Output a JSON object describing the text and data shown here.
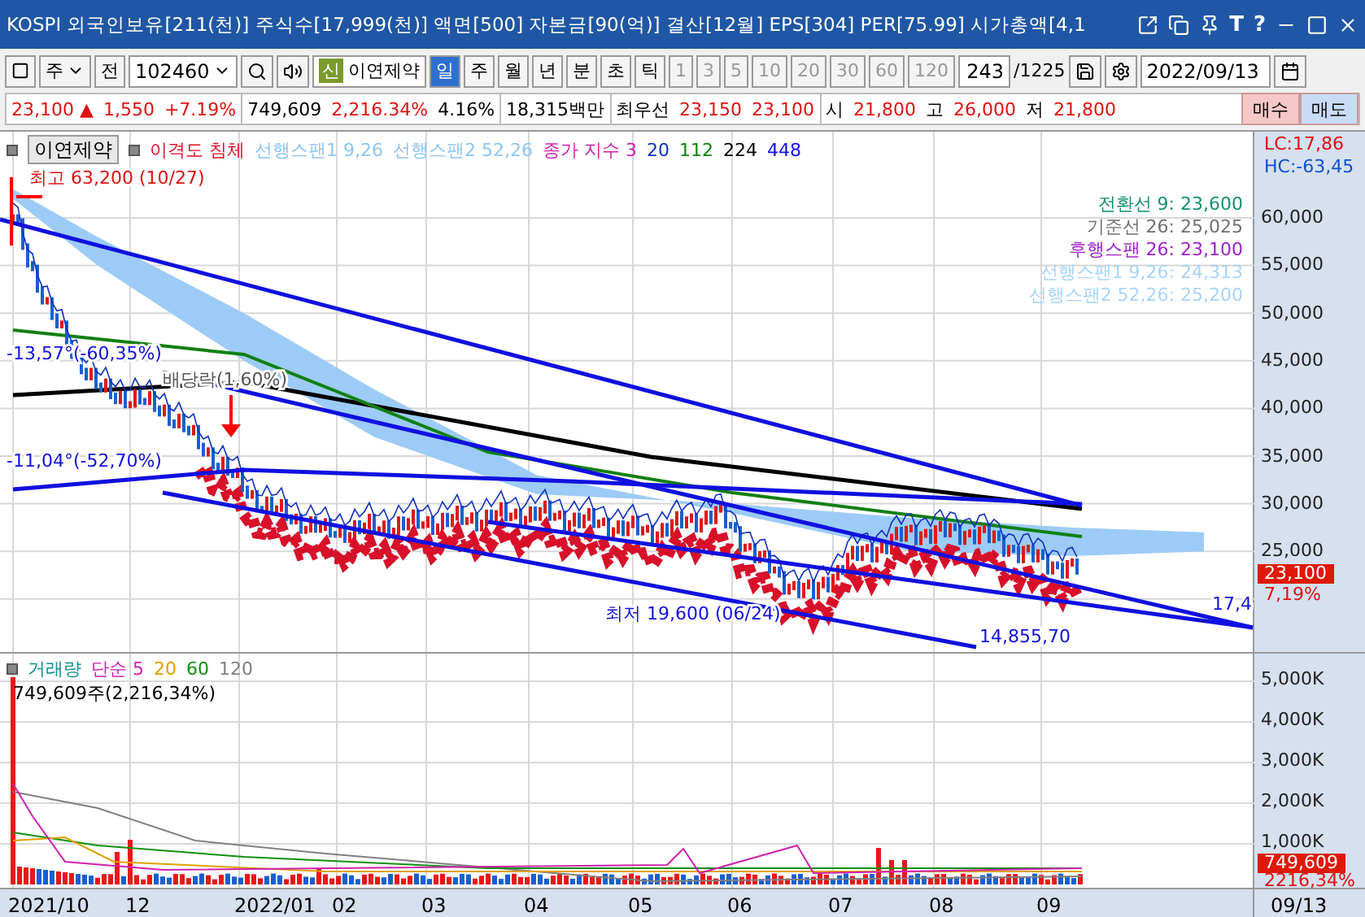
{
  "title_bar": {
    "text": "KOSPI 외국인보유[211(천)] 주식수[17,999(천)] 액면[500] 자본금[90(억)] 결산[12월] EPS[304] PER[75.99] 시가총액[4,1",
    "text_buttons": [
      "T",
      "?"
    ]
  },
  "toolbar": {
    "market": "주",
    "all_button": "전",
    "code": "102460",
    "badge": "신",
    "name": "이연제약",
    "periods": [
      {
        "label": "일",
        "selected": true
      },
      {
        "label": "주",
        "selected": false
      },
      {
        "label": "월",
        "selected": false
      },
      {
        "label": "년",
        "selected": false
      },
      {
        "label": "분",
        "selected": false
      },
      {
        "label": "초",
        "selected": false
      },
      {
        "label": "틱",
        "selected": false
      }
    ],
    "intervals": [
      {
        "label": "1",
        "disabled": true
      },
      {
        "label": "3",
        "disabled": true
      },
      {
        "label": "5",
        "disabled": true
      },
      {
        "label": "10",
        "disabled": true
      },
      {
        "label": "20",
        "disabled": true
      },
      {
        "label": "30",
        "disabled": true
      },
      {
        "label": "60",
        "disabled": true
      },
      {
        "label": "120",
        "disabled": true
      }
    ],
    "count": "243",
    "total": "/1225",
    "date": "2022/09/13"
  },
  "quote": {
    "price": "23,100",
    "arrow": "▲",
    "change": "1,550",
    "rate": "+7.19%",
    "volume": "749,609",
    "volume_rate": "2,216.34%",
    "turnover": "4.16%",
    "amount": "18,315백만",
    "best_label": "최우선",
    "ask": "23,150",
    "bid": "23,100",
    "open_label": "시",
    "open": "21,800",
    "high_label": "고",
    "high": "26,000",
    "low_label": "저",
    "low": "21,800",
    "buy": "매수",
    "sell": "매도"
  },
  "price_chart": {
    "name_button": "이연제약",
    "legend": [
      {
        "text": "이격도 침체",
        "color": "#e0102a"
      },
      {
        "text": "선행스팬1 9,26",
        "color": "#8ec6f5"
      },
      {
        "text": "선행스팬2 52,26",
        "color": "#8ec6f5"
      },
      {
        "text": "종가 지수 3",
        "color": "#d020b0"
      },
      {
        "text": "20",
        "color": "#1030c0"
      },
      {
        "text": "112",
        "color": "#108010"
      },
      {
        "text": "224",
        "color": "#000000"
      },
      {
        "text": "448",
        "color": "#1010ff"
      }
    ],
    "ichimoku": [
      {
        "text": "전환선 9: 23,600",
        "color": "#109070"
      },
      {
        "text": "기준선 26: 25,025",
        "color": "#707070"
      },
      {
        "text": "후행스팬 26: 23,100",
        "color": "#a020d0"
      },
      {
        "text": "선행스팬1 9,26: 24,313",
        "color": "#a8d4fa"
      },
      {
        "text": "선행스팬2 52,26: 25,200",
        "color": "#a8d4fa"
      }
    ],
    "annotations": [
      "최고 63,200 (10/27)",
      "-13,57°(-60,35%)",
      "배당락(1,60%)",
      "-11,04°(-52,70%)",
      "최저 19,600 (06/24)",
      "14,855,70",
      "17,4"
    ],
    "lc": "LC:17,86",
    "hc": "HC:-63,45",
    "yticks": [
      "60,000",
      "55,000",
      "50,000",
      "45,000",
      "40,000",
      "35,000",
      "30,000",
      "25,000"
    ],
    "price_tag": "23,100",
    "rate_tag": "7,19%"
  },
  "volume_chart": {
    "legend": [
      {
        "text": "거래량",
        "color": "#109090"
      },
      {
        "text": "단순 5",
        "color": "#d020b0"
      },
      {
        "text": "20",
        "color": "#e0a000"
      },
      {
        "text": "60",
        "color": "#109010"
      },
      {
        "text": "120",
        "color": "#808080"
      }
    ],
    "reading": "749,609주(2,216,34%)",
    "yticks": [
      "5,000K",
      "4,000K",
      "3,000K",
      "2,000K",
      "1,000K"
    ],
    "volume_tag": "749,609",
    "rate_tag": "2216,34%"
  },
  "x_axis": {
    "labels": [
      "2021/10",
      "12",
      "2022/01",
      "02",
      "03",
      "04",
      "05",
      "06",
      "07",
      "08",
      "09"
    ],
    "current": "09/13"
  }
}
